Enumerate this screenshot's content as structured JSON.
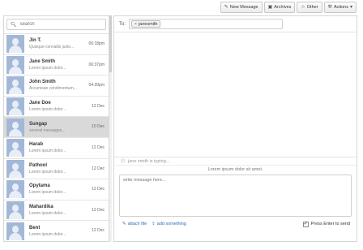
{
  "toolbar": {
    "new_message": "New Message",
    "archives": "Archives",
    "other": "Other",
    "actions": "Actions"
  },
  "search": {
    "placeholder": "search"
  },
  "contacts": [
    {
      "name": "Jin T.",
      "snippet": "Quisque convallis justo...",
      "time": "06:18pm"
    },
    {
      "name": "Jane Smith",
      "snippet": "Lorem ipsum dolor...",
      "time": "06:37pm"
    },
    {
      "name": "John Smith",
      "snippet": "Accumsan condimentum...",
      "time": "04:20pm"
    },
    {
      "name": "Jane Doe",
      "snippet": "Lorem ipsum dolor...",
      "time": "12 Dec"
    },
    {
      "name": "Sungap",
      "snippet": "several messages...",
      "time": "10 Dec"
    },
    {
      "name": "Harab",
      "snippet": "Lorem ipsum dolor...",
      "time": "12 Dec"
    },
    {
      "name": "Pathool",
      "snippet": "Lorem ipsum dolor...",
      "time": "12 Dec"
    },
    {
      "name": "Opytama",
      "snippet": "Lorem ipsum dolor...",
      "time": "12 Dec"
    },
    {
      "name": "Mahardika",
      "snippet": "Lorem ipsum dolor...",
      "time": "12 Dec"
    },
    {
      "name": "Bent",
      "snippet": "Lorem ipsum dolor...",
      "time": "12 Dec"
    }
  ],
  "active_contact_index": 4,
  "compose": {
    "to_label": "To:",
    "recipient": "janesmith",
    "typing_status": "jane smith is typing...",
    "notice": "Lorem ipsum dolor sit amet.",
    "placeholder": "write message here...",
    "attach_label": "attach file",
    "add_label": "add something",
    "enter_label": "Press Enter to send",
    "enter_checked": true
  },
  "icons": {
    "new_message": "pencil-icon",
    "archives": "archive-icon",
    "other": "star-icon",
    "actions": "wrench-icon",
    "search": "search-icon",
    "typing": "chat-bubble-icon",
    "attach": "paperclip-icon",
    "add": "upload-icon"
  }
}
